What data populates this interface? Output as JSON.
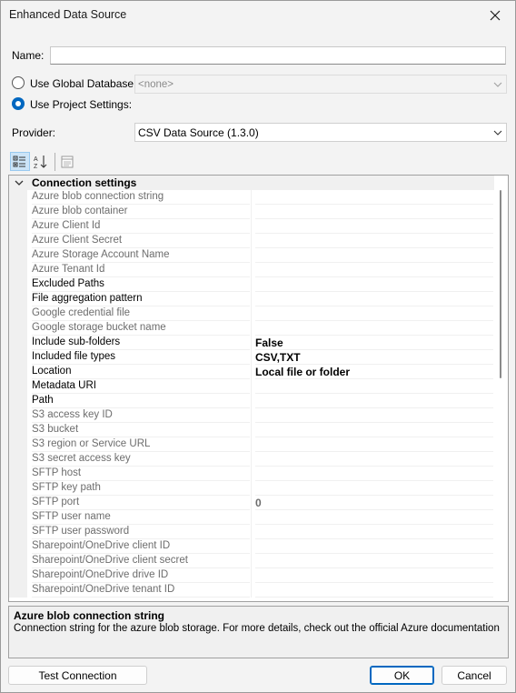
{
  "window": {
    "title": "Enhanced Data Source"
  },
  "form": {
    "name_label": "Name:",
    "name_value": "",
    "use_global_label": "Use Global Database:",
    "global_db_value": "<none>",
    "use_project_label": "Use Project Settings:",
    "selected_mode": "project",
    "provider_label": "Provider:",
    "provider_value": "CSV Data Source (1.3.0)"
  },
  "toolbar": {
    "categorized_icon": "categorized-icon",
    "alphabetical_icon": "alphabetical-sort-icon",
    "property_pages_icon": "property-pages-icon"
  },
  "grid": {
    "category": "Connection settings",
    "properties": [
      {
        "name": "Azure blob connection string",
        "value": "",
        "dim": true
      },
      {
        "name": "Azure blob container",
        "value": "",
        "dim": true
      },
      {
        "name": "Azure Client Id",
        "value": "",
        "dim": true
      },
      {
        "name": "Azure Client Secret",
        "value": "",
        "dim": true
      },
      {
        "name": "Azure Storage Account Name",
        "value": "",
        "dim": true
      },
      {
        "name": "Azure Tenant Id",
        "value": "",
        "dim": true
      },
      {
        "name": "Excluded Paths",
        "value": "",
        "dim": false
      },
      {
        "name": "File aggregation pattern",
        "value": "",
        "dim": false
      },
      {
        "name": "Google credential file",
        "value": "",
        "dim": true
      },
      {
        "name": "Google storage bucket name",
        "value": "",
        "dim": true
      },
      {
        "name": "Include sub-folders",
        "value": "False",
        "dim": false
      },
      {
        "name": "Included file types",
        "value": "CSV,TXT",
        "dim": false
      },
      {
        "name": "Location",
        "value": "Local file or folder",
        "dim": false
      },
      {
        "name": "Metadata URI",
        "value": "",
        "dim": false
      },
      {
        "name": "Path",
        "value": "",
        "dim": false
      },
      {
        "name": "S3 access key ID",
        "value": "",
        "dim": true
      },
      {
        "name": "S3 bucket",
        "value": "",
        "dim": true
      },
      {
        "name": "S3 region or Service URL",
        "value": "",
        "dim": true
      },
      {
        "name": "S3 secret access key",
        "value": "",
        "dim": true
      },
      {
        "name": "SFTP host",
        "value": "",
        "dim": true
      },
      {
        "name": "SFTP key path",
        "value": "",
        "dim": true
      },
      {
        "name": "SFTP port",
        "value": "0",
        "dim": true
      },
      {
        "name": "SFTP user name",
        "value": "",
        "dim": true
      },
      {
        "name": "SFTP user password",
        "value": "",
        "dim": true
      },
      {
        "name": "Sharepoint/OneDrive client ID",
        "value": "",
        "dim": true
      },
      {
        "name": "Sharepoint/OneDrive client secret",
        "value": "",
        "dim": true
      },
      {
        "name": "Sharepoint/OneDrive drive ID",
        "value": "",
        "dim": true
      },
      {
        "name": "Sharepoint/OneDrive tenant ID",
        "value": "",
        "dim": true
      }
    ],
    "scrollbar_position_fraction": 0.0
  },
  "help": {
    "title": "Azure blob connection string",
    "description": "Connection string for the azure blob storage. For more details, check out the official Azure documentation"
  },
  "buttons": {
    "test_connection": "Test Connection",
    "ok": "OK",
    "cancel": "Cancel"
  }
}
